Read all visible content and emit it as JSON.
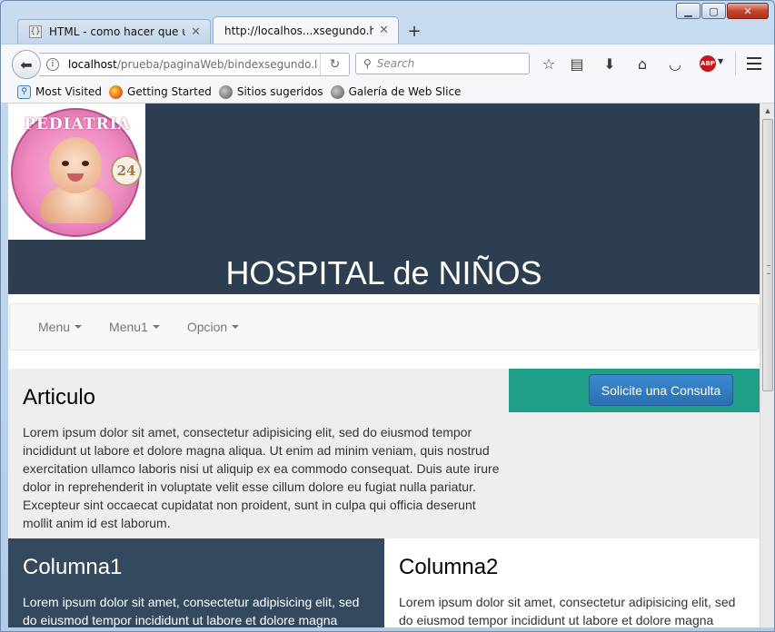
{
  "browser": {
    "tabs": [
      {
        "title": "HTML - como hacer que u...",
        "favicon": "{}"
      },
      {
        "title": "http://localhos...xsegundo.html#"
      }
    ],
    "url_host": "localhost",
    "url_path": "/prueba/paginaWeb/bindexsegundo.l",
    "search_placeholder": "Search",
    "abp_label": "ABP",
    "bookmarks": [
      {
        "label": "Most Visited",
        "icon": "most-visited-icon"
      },
      {
        "label": "Getting Started",
        "icon": "firefox-icon"
      },
      {
        "label": "Sitios sugeridos",
        "icon": "globe-icon"
      },
      {
        "label": "Galería de Web Slice",
        "icon": "globe-icon"
      }
    ]
  },
  "page": {
    "logo_text": "PEDIATRIA",
    "logo_badge": "24",
    "title": "HOSPITAL de NIÑOS",
    "nav": [
      "Menu",
      "Menu1",
      "Opcion"
    ],
    "article": {
      "heading": "Articulo",
      "body": "Lorem ipsum dolor sit amet, consectetur adipisicing elit, sed do eiusmod tempor incididunt ut labore et dolore magna aliqua. Ut enim ad minim veniam, quis nostrud exercitation ullamco laboris nisi ut aliquip ex ea commodo consequat. Duis aute irure dolor in reprehenderit in voluptate velit esse cillum dolore eu fugiat nulla pariatur. Excepteur sint occaecat cupidatat non proident, sunt in culpa qui officia deserunt mollit anim id est laborum."
    },
    "cta_label": "Solicite una Consulta",
    "columns": [
      {
        "heading": "Columna1",
        "body": "Lorem ipsum dolor sit amet, consectetur adipisicing elit, sed do eiusmod tempor incididunt ut labore et dolore magna"
      },
      {
        "heading": "Columna2",
        "body": "Lorem ipsum dolor sit amet, consectetur adipisicing elit, sed do eiusmod tempor incididunt ut labore et dolore magna"
      }
    ]
  },
  "colors": {
    "header_bg": "#2c3e50",
    "cta_panel": "#1f9f85",
    "cta_button": "#2a6fb0",
    "column1_bg": "#34495e"
  }
}
